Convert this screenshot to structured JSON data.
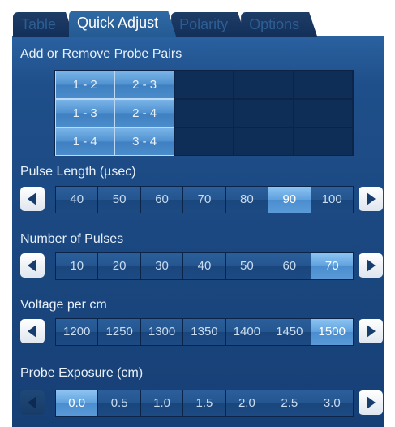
{
  "tabs": [
    {
      "label": "Table",
      "active": false
    },
    {
      "label": "Quick Adjust",
      "active": true
    },
    {
      "label": "Polarity",
      "active": false
    },
    {
      "label": "Options",
      "active": false
    }
  ],
  "probe_pairs": {
    "title": "Add or Remove Probe Pairs",
    "cells": [
      [
        "1 - 2",
        "2 - 3",
        "",
        "",
        ""
      ],
      [
        "1 - 3",
        "2 - 4",
        "",
        "",
        ""
      ],
      [
        "1 - 4",
        "3 - 4",
        "",
        "",
        ""
      ]
    ]
  },
  "pulse_length": {
    "title": "Pulse Length (µsec)",
    "options": [
      "40",
      "50",
      "60",
      "70",
      "80",
      "90",
      "100"
    ],
    "selected": "90"
  },
  "number_of_pulses": {
    "title": "Number of Pulses",
    "options": [
      "10",
      "20",
      "30",
      "40",
      "50",
      "60",
      "70"
    ],
    "selected": "70"
  },
  "voltage_per_cm": {
    "title": "Voltage per cm",
    "options": [
      "1200",
      "1250",
      "1300",
      "1350",
      "1400",
      "1450",
      "1500"
    ],
    "selected": "1500"
  },
  "probe_exposure": {
    "title": "Probe Exposure (cm)",
    "options": [
      "0.0",
      "0.5",
      "1.0",
      "1.5",
      "2.0",
      "2.5",
      "3.0"
    ],
    "selected": "0.0"
  },
  "icons": {
    "left": "arrow-left-icon",
    "right": "arrow-right-icon"
  },
  "colors": {
    "panel": "#1f4f8a",
    "selected": "#5fa1dd",
    "grid_empty": "#0f2e57"
  }
}
